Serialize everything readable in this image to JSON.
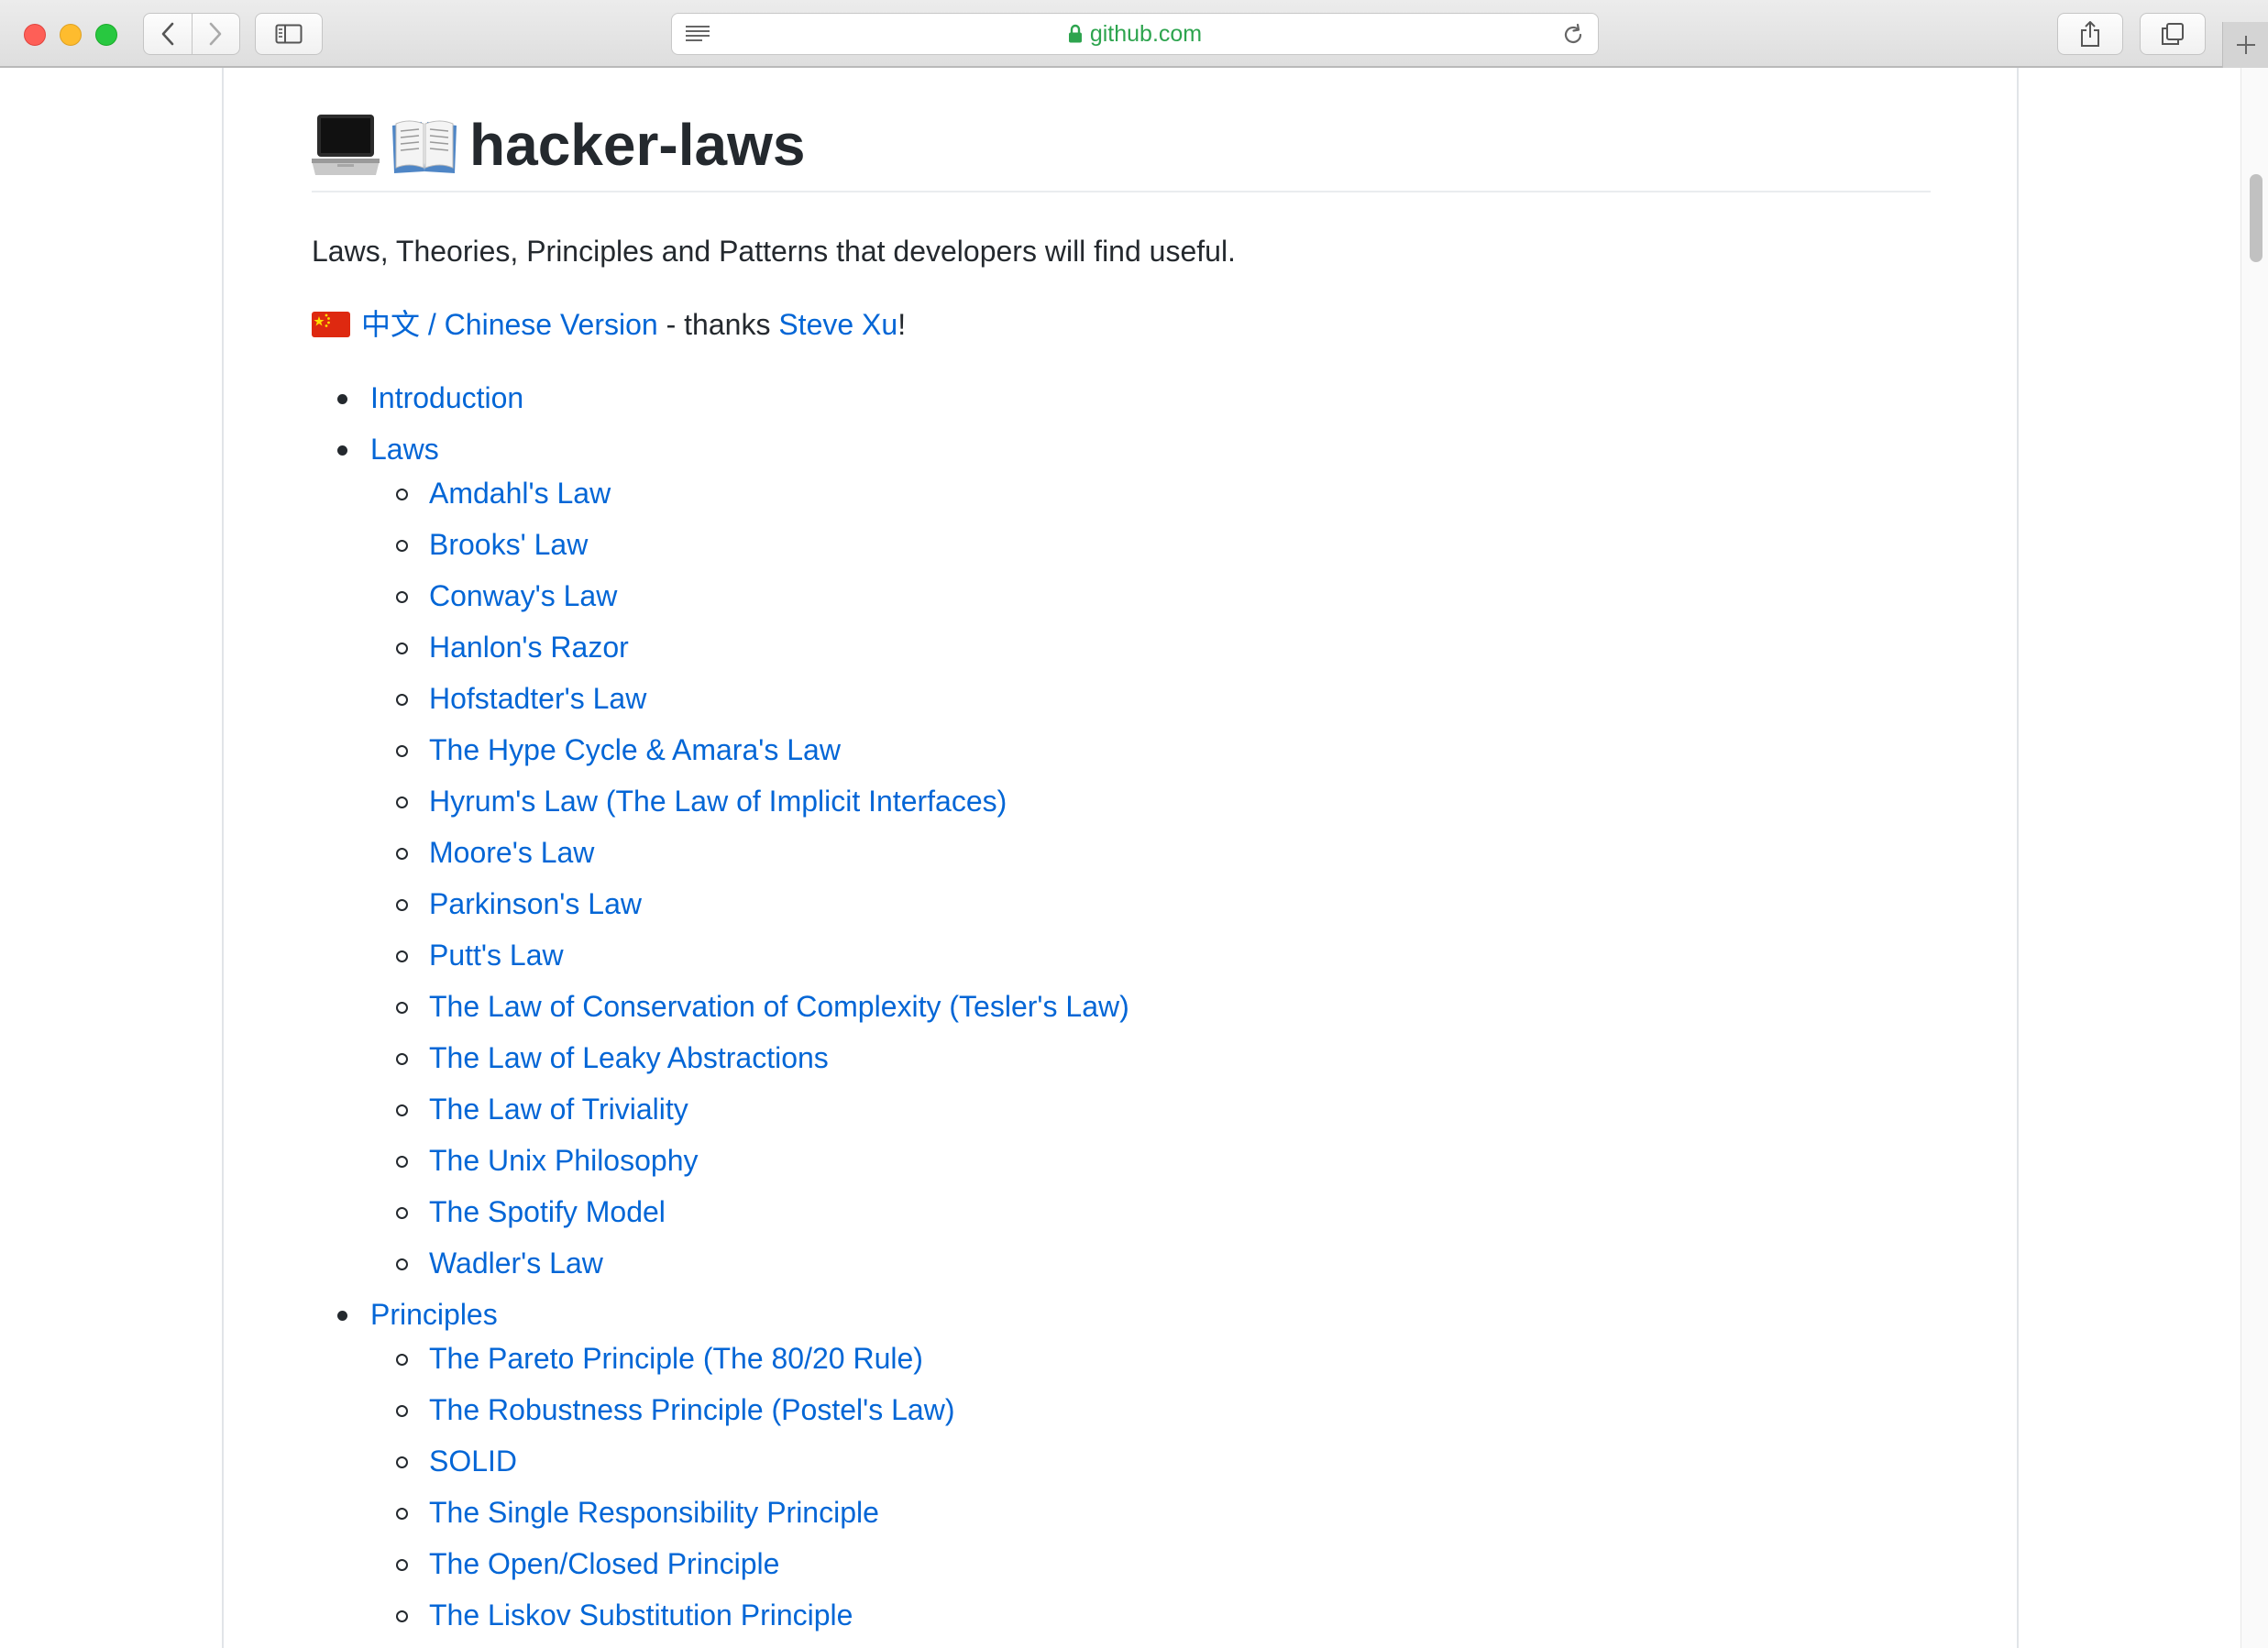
{
  "browser": {
    "url": "github.com",
    "buttons": {
      "back": "back-icon",
      "forward": "forward-icon",
      "sidebar": "sidebar-icon",
      "reader": "reader-icon",
      "reload": "reload-icon",
      "share": "share-icon",
      "tabs": "tabs-icon",
      "new_tab": "plus-icon"
    },
    "colors": {
      "url_text": "#2da44e",
      "link": "#0366d6",
      "text": "#24292e"
    }
  },
  "readme": {
    "title": "hacker-laws",
    "title_emoji": [
      "laptop-icon",
      "open-book-icon"
    ],
    "intro": "Laws, Theories, Principles and Patterns that developers will find useful.",
    "chinese_line": {
      "flag": "china-flag-icon",
      "link_text": "中文 / Chinese Version",
      "middle_text": " - thanks ",
      "author_link": "Steve Xu",
      "suffix": "!"
    },
    "toc": [
      {
        "label": "Introduction",
        "children": []
      },
      {
        "label": "Laws",
        "children": [
          "Amdahl's Law",
          "Brooks' Law",
          "Conway's Law",
          "Hanlon's Razor",
          "Hofstadter's Law",
          "The Hype Cycle & Amara's Law",
          "Hyrum's Law (The Law of Implicit Interfaces)",
          "Moore's Law",
          "Parkinson's Law",
          "Putt's Law",
          "The Law of Conservation of Complexity (Tesler's Law)",
          "The Law of Leaky Abstractions",
          "The Law of Triviality",
          "The Unix Philosophy",
          "The Spotify Model",
          "Wadler's Law"
        ]
      },
      {
        "label": "Principles",
        "children": [
          "The Pareto Principle (The 80/20 Rule)",
          "The Robustness Principle (Postel's Law)",
          "SOLID",
          "The Single Responsibility Principle",
          "The Open/Closed Principle",
          "The Liskov Substitution Principle"
        ]
      }
    ]
  }
}
